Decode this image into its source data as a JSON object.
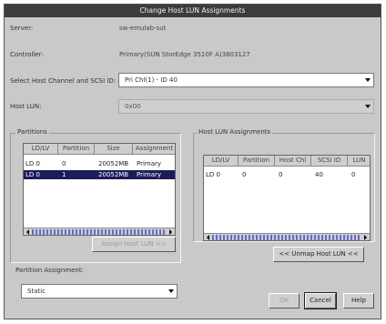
{
  "window": {
    "title": "Change Host LUN Assignments"
  },
  "form": {
    "server_label": "Server:",
    "server_value": "sw-emulab-sut",
    "controller_label": "Controller:",
    "controller_value": "Primary(SUN StorEdge 3510F A)3803127",
    "channel_label": "Select Host Channel and SCSI ID:",
    "channel_value": "Pri Chl(1) - ID 40",
    "lun_label": "Host LUN:",
    "lun_value": "0x00"
  },
  "partitions": {
    "title": "Partitions",
    "columns": [
      "LD/LV",
      "Partition",
      "Size",
      "Assignment"
    ],
    "rows": [
      {
        "ld": "LD 0",
        "partition": "0",
        "size": "20052MB",
        "assignment": "Primary"
      },
      {
        "ld": "LD 0",
        "partition": "1",
        "size": "20052MB",
        "assignment": "Primary"
      }
    ],
    "assign_button": "Assign Host LUN >>"
  },
  "host_lun": {
    "title": "Host LUN Assignments",
    "columns": [
      "LD/LV",
      "Partition",
      "Host Chl",
      "SCSI ID",
      "LUN"
    ],
    "rows": [
      {
        "ld": "LD 0",
        "partition": "0",
        "chl": "0",
        "scsi": "40",
        "lun": "0"
      }
    ],
    "unmap_button": "<< Unmap Host LUN <<"
  },
  "partition_assignment": {
    "label": "Partition Assignment:",
    "value": "Static"
  },
  "buttons": {
    "ok": "OK",
    "cancel": "Cancel",
    "help": "Help"
  }
}
